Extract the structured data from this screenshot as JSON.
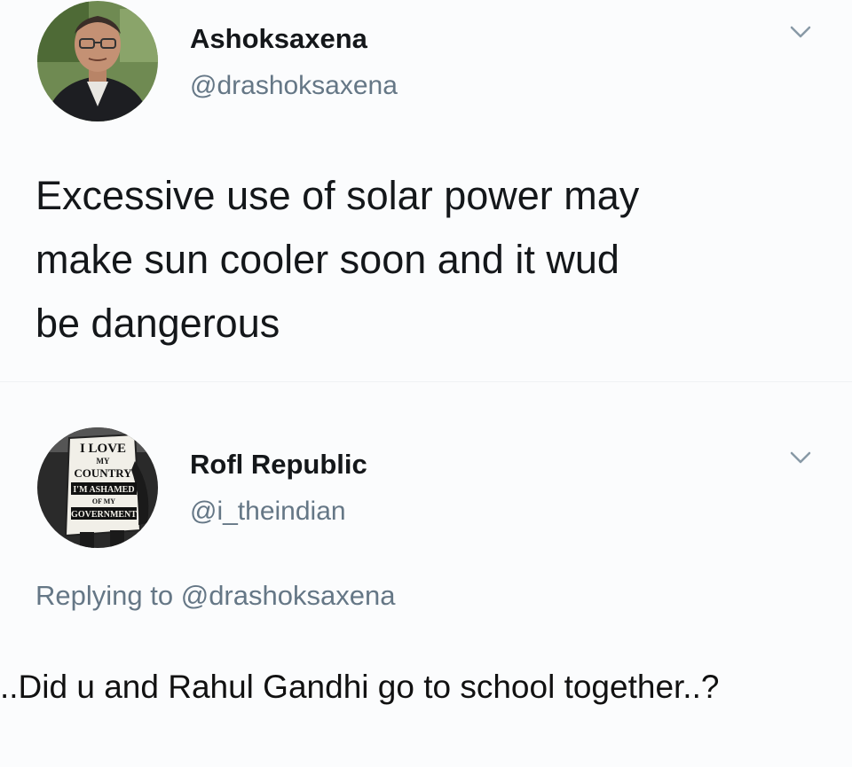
{
  "tweet": {
    "author": {
      "display_name": "Ashoksaxena",
      "handle": "@drashoksaxena"
    },
    "text_lines": [
      "Excessive use of solar power may",
      "make sun cooler soon and it wud",
      "be dangerous"
    ]
  },
  "reply": {
    "author": {
      "display_name": "Rofl Republic",
      "handle": "@i_theindian"
    },
    "avatar_sign": {
      "line1": "I LOVE",
      "line2": "MY",
      "line3": "COUNTRY",
      "line4": "I'M ASHAMED",
      "line5": "OF MY",
      "line6": "GOVERNMENT"
    },
    "replying_to_prefix": "Replying to",
    "replying_to_handle": "@drashoksaxena",
    "text": "..Did u and Rahul Gandhi go to school together..?"
  },
  "colors": {
    "primary_text": "#14171a",
    "secondary_text": "#657786",
    "background": "#fbfcfd"
  },
  "icons": {
    "menu": "chevron-down-icon"
  }
}
